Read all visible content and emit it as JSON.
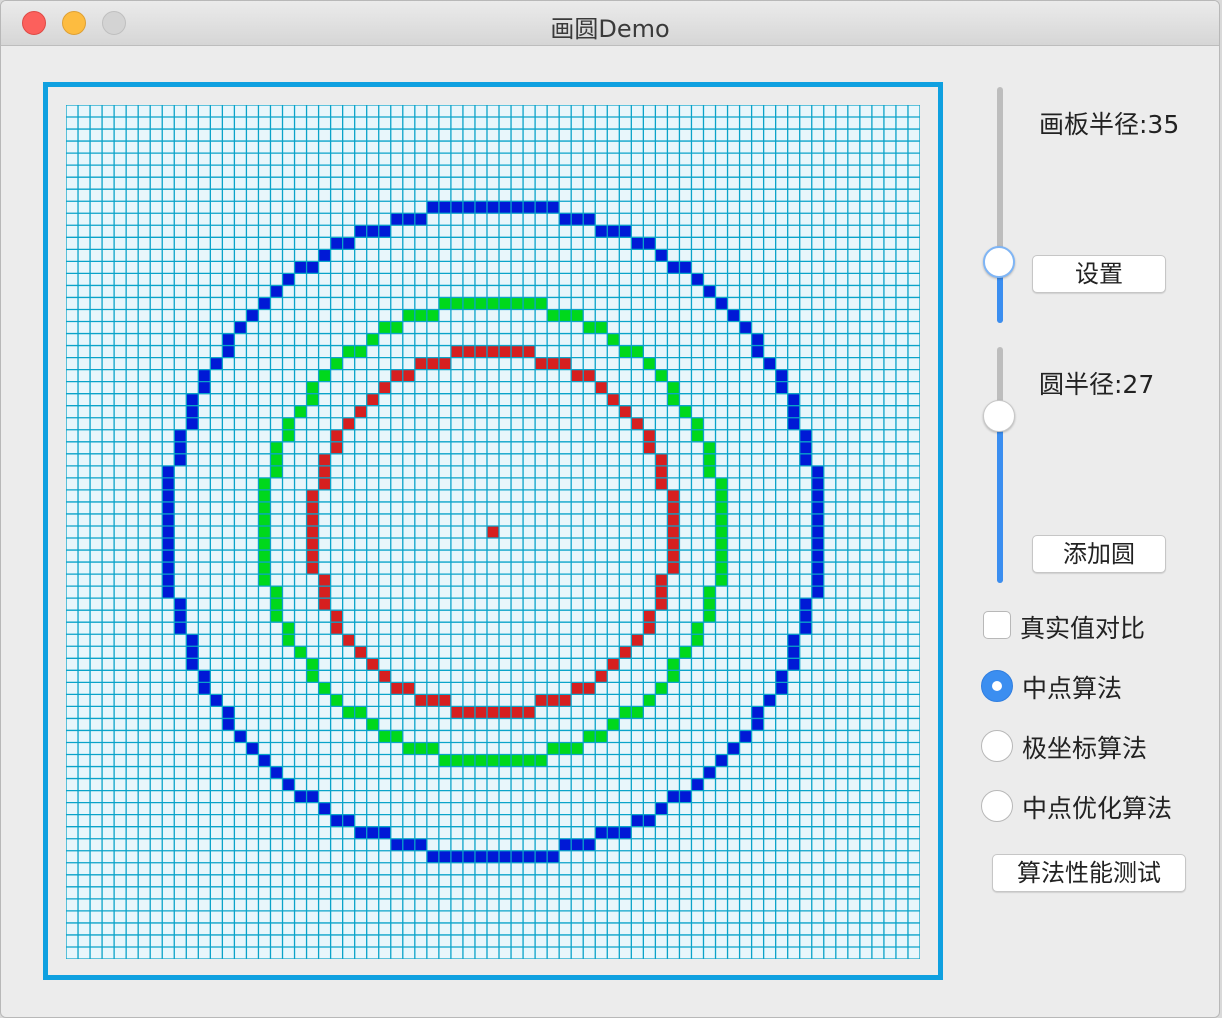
{
  "window": {
    "title": "画圆Demo"
  },
  "controls": {
    "board_radius_label": "画板半径:35",
    "board_radius_slider": {
      "value": 35,
      "fraction": 0.22
    },
    "set_button": "设置",
    "circle_radius_label": "圆半径:27",
    "circle_radius_slider": {
      "value": 27,
      "fraction": 0.74
    },
    "add_circle_button": "添加圆",
    "compare_checkbox": {
      "label": "真实值对比",
      "checked": false
    },
    "algorithms": [
      {
        "label": "中点算法",
        "selected": true
      },
      {
        "label": "极坐标算法",
        "selected": false
      },
      {
        "label": "中点优化算法",
        "selected": false
      }
    ],
    "perf_test_button": "算法性能测试"
  },
  "canvas": {
    "grid_size": 71,
    "center": [
      35,
      35
    ],
    "grid_color": "#0aa3c9",
    "cell_bg": "#e8f6fb",
    "center_color": "#d61f1f",
    "circles": [
      {
        "radius": 27,
        "color": "#0019d6"
      },
      {
        "radius": 19,
        "color": "#00d81c"
      },
      {
        "radius": 15,
        "color": "#d61f1f"
      }
    ]
  },
  "colors": {
    "accent": "#3b8ef0",
    "board_border": "#0fa0e0"
  }
}
